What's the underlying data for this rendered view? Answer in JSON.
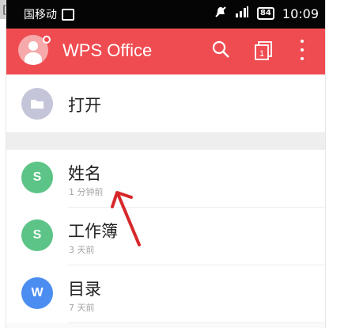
{
  "status_bar": {
    "carrier": "国移动",
    "time": "10:09",
    "signal": "\u0001\u0001",
    "battery": "84"
  },
  "appbar": {
    "title": "WPS Office"
  },
  "open_row": {
    "label": "打开"
  },
  "recent_files": [
    {
      "icon_letter": "S",
      "icon_color": "#5cc487",
      "name": "姓名",
      "time": "1 分钟前"
    },
    {
      "icon_letter": "S",
      "icon_color": "#5cc487",
      "name": "工作簿",
      "time": "3 天前"
    },
    {
      "icon_letter": "W",
      "icon_color": "#4b8df0",
      "name": "目录",
      "time": "7 天前"
    }
  ],
  "colors": {
    "appbar": "#ef4c51",
    "open_icon": "#c5c5da"
  }
}
